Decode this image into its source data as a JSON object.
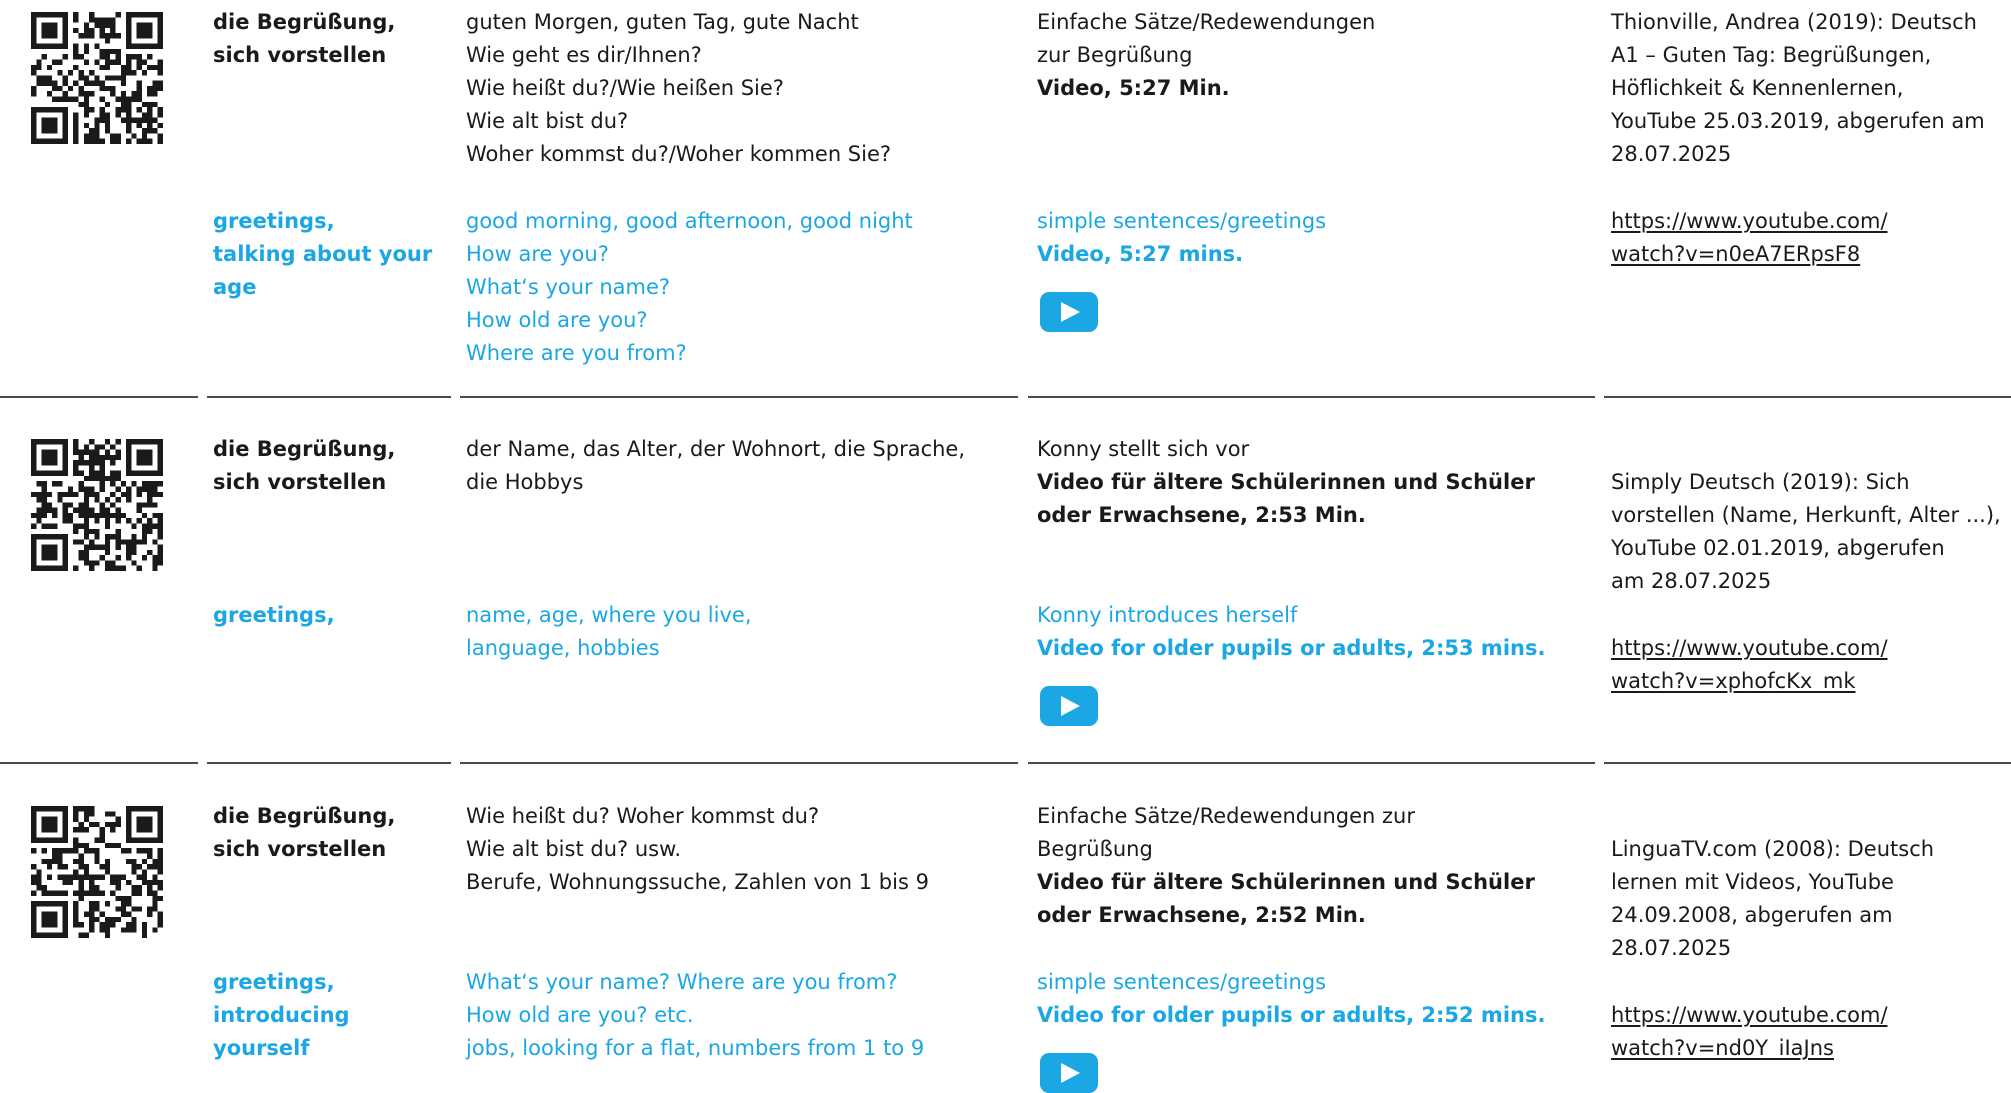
{
  "entries": [
    {
      "topic_de": [
        "die Begrüßung,",
        "sich vorstellen"
      ],
      "topic_en": [
        "greetings,",
        "talking about your",
        "age"
      ],
      "words_de": [
        "guten Morgen, guten Tag, gute Nacht",
        "Wie geht es dir/Ihnen?",
        "Wie heißt du?/Wie heißen Sie?",
        "Wie alt bist du?",
        "Woher kommst du?/Woher kommen Sie?"
      ],
      "words_en": [
        "good morning, good afternoon, good night",
        "How are you?",
        "What‘s your name?",
        "How old are you?",
        "Where are you from?"
      ],
      "media_de": [
        "Einfache Sätze/Redewendungen",
        "zur Begrüßung"
      ],
      "media_de_bold": [
        "Video, 5:27 Min."
      ],
      "media_en": [
        "simple sentences/greetings"
      ],
      "media_en_bold": [
        "Video, 5:27 mins."
      ],
      "source": [
        "Thionville, Andrea (2019): Deutsch",
        "A1 – Guten Tag: Begrüßungen,",
        "Höflichkeit & Kennenlernen,",
        "YouTube 25.03.2019, abgerufen am",
        "28.07.2025"
      ],
      "link": [
        "https://www.youtube.com/",
        "watch?v=n0eA7ERpsF8"
      ]
    },
    {
      "topic_de": [
        "die Begrüßung,",
        "sich vorstellen"
      ],
      "topic_en": [
        "greetings,"
      ],
      "words_de": [
        "der Name, das Alter, der Wohnort, die Sprache,",
        "die Hobbys"
      ],
      "words_en": [
        "name, age, where you live,",
        "language, hobbies"
      ],
      "media_de": [
        "Konny stellt sich vor"
      ],
      "media_de_bold": [
        "Video für ältere Schülerinnen und Schüler",
        "oder Erwachsene, 2:53 Min."
      ],
      "media_en": [
        "Konny introduces herself"
      ],
      "media_en_bold": [
        "Video for older pupils or adults, 2:53 mins."
      ],
      "source": [
        "Simply Deutsch (2019): Sich",
        "vorstellen (Name, Herkunft, Alter ...),",
        "YouTube 02.01.2019, abgerufen",
        "am 28.07.2025"
      ],
      "link": [
        "https://www.youtube.com/",
        "watch?v=xphofcKx_mk"
      ]
    },
    {
      "topic_de": [
        "die Begrüßung,",
        "sich vorstellen"
      ],
      "topic_en": [
        "greetings,",
        "introducing",
        "yourself"
      ],
      "words_de": [
        "Wie heißt du? Woher kommst du?",
        "Wie alt bist du? usw.",
        "Berufe, Wohnungssuche, Zahlen von 1 bis 9"
      ],
      "words_en": [
        "What‘s your name? Where are you from?",
        "How old are you? etc.",
        "jobs, looking for a flat, numbers from 1 to 9"
      ],
      "media_de": [
        "Einfache Sätze/Redewendungen zur",
        "Begrüßung"
      ],
      "media_de_bold": [
        "Video für ältere Schülerinnen und Schüler",
        "oder Erwachsene, 2:52 Min."
      ],
      "media_en": [
        "simple sentences/greetings"
      ],
      "media_en_bold": [
        "Video for older pupils or adults, 2:52 mins."
      ],
      "source": [
        "LinguaTV.com (2008): Deutsch",
        "lernen mit Videos, YouTube",
        "24.09.2008, abgerufen am",
        "28.07.2025"
      ],
      "link": [
        "https://www.youtube.com/",
        "watch?v=nd0Y_iIaJns"
      ]
    }
  ],
  "colors": {
    "accent": "#1aa7e3",
    "text": "#1a1a1a",
    "rule": "#4a4a4a"
  },
  "icons": {
    "qr": "qr-code-icon",
    "play": "play-icon"
  }
}
